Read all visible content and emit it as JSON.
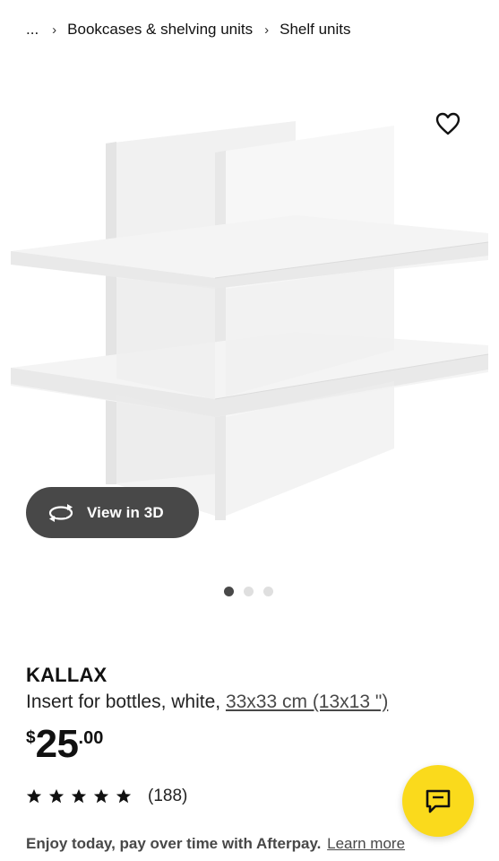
{
  "breadcrumb": {
    "ellipsis": "...",
    "items": [
      "Bookcases & shelving units",
      "Shelf units"
    ]
  },
  "gallery": {
    "view_3d_label": "View in 3D",
    "dots_count": 3,
    "active_dot": 1
  },
  "product": {
    "name": "KALLAX",
    "description": "Insert for bottles, white, ",
    "size_link": "33x33 cm (13x13 \")",
    "price": {
      "currency": "$",
      "integer": "25",
      "decimal": ".00"
    },
    "rating": {
      "stars": 5,
      "count": "(188)"
    }
  },
  "afterpay": {
    "text": "Enjoy today, pay over time with Afterpay.",
    "link": "Learn more"
  },
  "colors": {
    "chat_button": "#fada1c",
    "pill_bg": "#484848",
    "text": "#111111"
  },
  "icons": [
    "heart-icon",
    "rotate-3d-icon",
    "star-icon",
    "chat-icon",
    "chevron-right-icon"
  ]
}
